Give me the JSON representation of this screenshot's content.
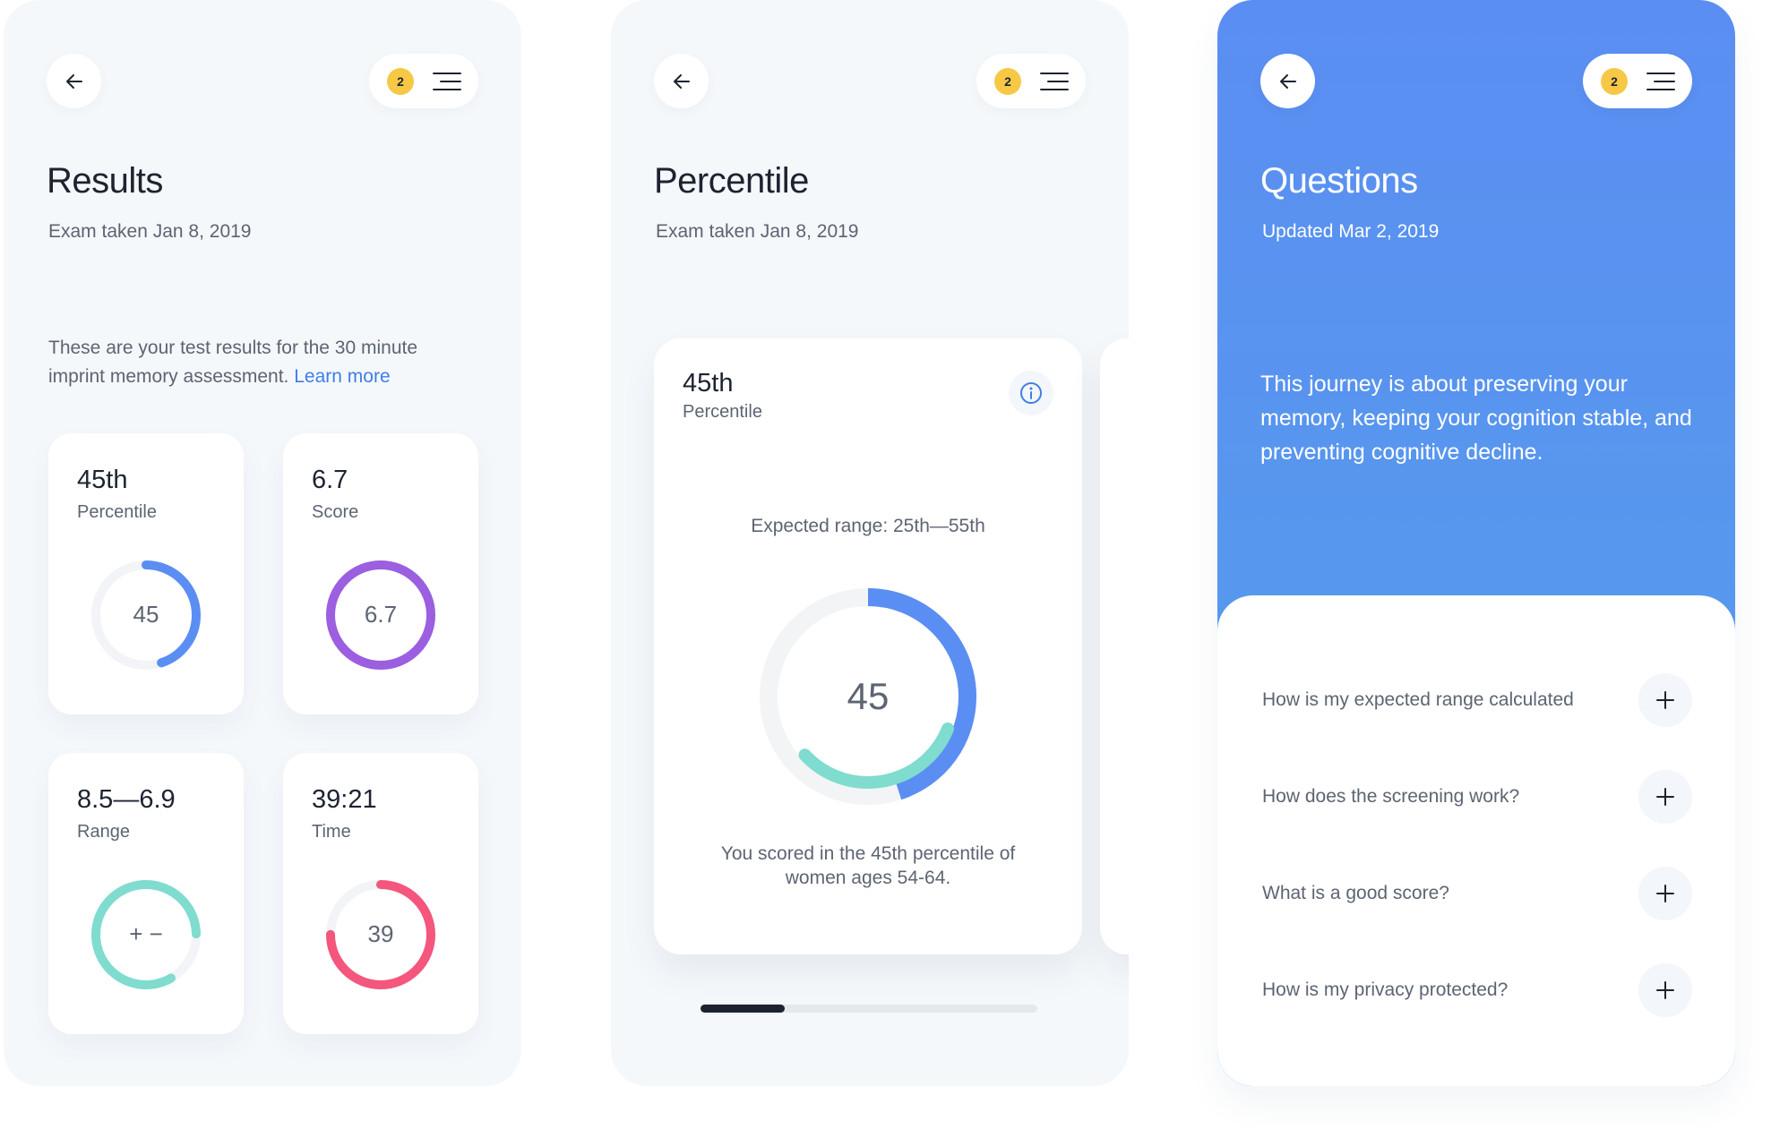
{
  "results": {
    "badge_count": "2",
    "title": "Results",
    "subtitle": "Exam taken Jan 8, 2019",
    "intro_text": "These are your test results for the 30 minute imprint memory assessment.",
    "learn_more": "Learn more",
    "cards": [
      {
        "value": "45th",
        "label": "Percentile",
        "ring_text": "45",
        "ring_color": "#5b8ef2",
        "ring_fraction": 0.45
      },
      {
        "value": "6.7",
        "label": "Score",
        "ring_text": "6.7",
        "ring_color": "#9b5fe0",
        "ring_fraction": 1.0
      },
      {
        "value": "8.5—6.9",
        "label": "Range",
        "ring_text": "+ −",
        "ring_color": "#7fdcce",
        "ring_fraction": 0.83
      },
      {
        "value": "39:21",
        "label": "Time",
        "ring_text": "39",
        "ring_color": "#f4567d",
        "ring_fraction": 0.75
      }
    ]
  },
  "percentile": {
    "badge_count": "2",
    "title": "Percentile",
    "subtitle": "Exam taken Jan 8, 2019",
    "card_value": "45th",
    "card_label": "Percentile",
    "expected_range": "Expected range: 25th—55th",
    "center_value": "45",
    "caption": "You scored in the 45th percentile of women ages 54-64.",
    "outer_ring_fraction": 0.45,
    "inner_ring_fraction": 0.32,
    "outer_ring_color": "#5b8ef2",
    "inner_ring_color": "#7fdcce",
    "carousel_progress": 0.25
  },
  "questions": {
    "badge_count": "2",
    "title": "Questions",
    "subtitle": "Updated Mar 2, 2019",
    "intro_text": "This journey is about preserving your memory, keeping your cognition stable, and preventing cognitive decline.",
    "faqs": [
      {
        "label": "How is my expected range calculated"
      },
      {
        "label": "How does the screening work?"
      },
      {
        "label": "What is a good score?"
      },
      {
        "label": "How is my privacy protected?"
      }
    ],
    "gradient_top": "#5b8ef2",
    "gradient_bottom": "#53a0ea"
  },
  "icons": [
    "arrow-left-icon",
    "menu-icon",
    "info-icon",
    "plus-icon"
  ]
}
